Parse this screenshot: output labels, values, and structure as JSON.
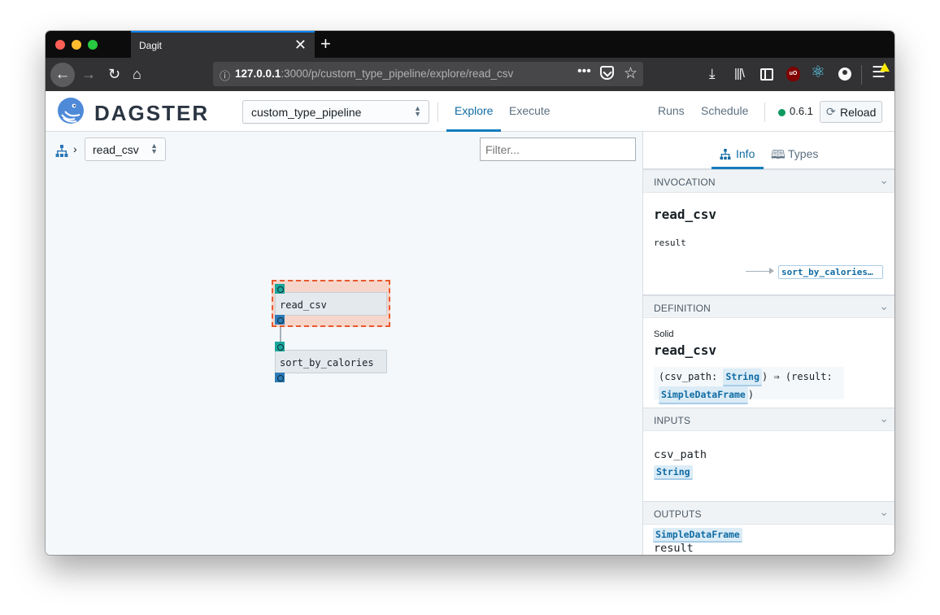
{
  "browser": {
    "tab_title": "Dagit",
    "tab_close": "✕",
    "new_tab": "+",
    "url_host": "127.0.0.1",
    "url_rest": ":3000/p/custom_type_pipeline/explore/read_csv",
    "url_dots": "•••",
    "icons": [
      "back-arrow-icon",
      "forward-arrow-icon",
      "reload-icon",
      "home-icon",
      "info-icon",
      "pocket-icon",
      "bookmark-star-icon",
      "download-icon",
      "library-icon",
      "sidebar-icon",
      "ublock-icon",
      "react-devtools-icon",
      "account-icon",
      "menu-icon",
      "warning-icon"
    ],
    "ublock_badge": "uO"
  },
  "header": {
    "brand": "DAGSTER",
    "pipeline": "custom_type_pipeline",
    "tabs": [
      {
        "label": "Explore",
        "active": true
      },
      {
        "label": "Execute",
        "active": false
      }
    ],
    "runs": "Runs",
    "schedule": "Schedule",
    "version": "0.6.1",
    "reload": "Reload",
    "status_color": "#0f9960"
  },
  "canvas": {
    "breadcrumb_solid": "read_csv",
    "filter_placeholder": "Filter...",
    "nodes": [
      {
        "label": "read_csv",
        "selected": true
      },
      {
        "label": "sort_by_calories",
        "selected": false
      }
    ]
  },
  "panel": {
    "tabs": [
      {
        "label": "Info",
        "active": true
      },
      {
        "label": "Types",
        "active": false
      }
    ],
    "invocation": {
      "header": "INVOCATION",
      "name": "read_csv",
      "output_name": "result",
      "output_target": "sort_by_calories…"
    },
    "definition": {
      "header": "DEFINITION",
      "kind": "Solid",
      "name": "read_csv",
      "sig_open": "(csv_path:",
      "sig_in_type": "String",
      "sig_mid": ") ⇒ (result:",
      "sig_out_type": "SimpleDataFrame",
      "sig_close": ")"
    },
    "inputs": {
      "header": "INPUTS",
      "name": "csv_path",
      "type": "String"
    },
    "outputs": {
      "header": "OUTPUTS",
      "name": "result",
      "type": "SimpleDataFrame"
    }
  },
  "colors": {
    "accent": "#137cbd",
    "selected_fill": "#f6d6cb",
    "selected_border": "#e8582e",
    "input_port": "#1ba69a",
    "output_port": "#2c7cb8"
  }
}
